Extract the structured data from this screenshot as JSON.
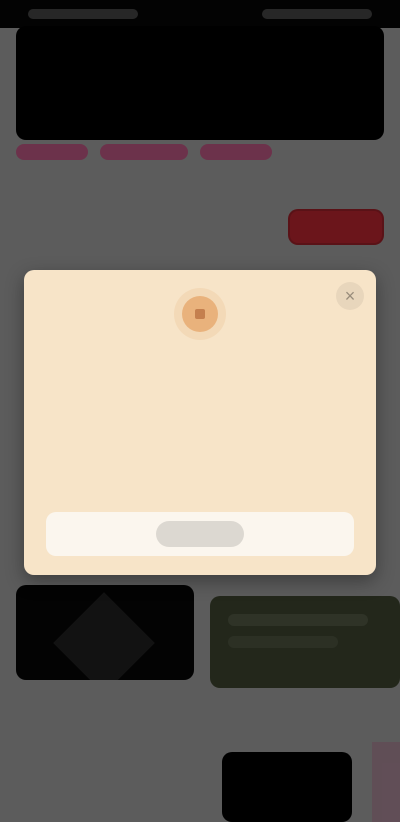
{
  "status_bar": {
    "time": "",
    "left_text": "",
    "right_text": ""
  },
  "header": {
    "title": "",
    "subtitle": ""
  },
  "tabs": [
    {
      "label": ""
    },
    {
      "label": ""
    },
    {
      "label": ""
    }
  ],
  "subheader": {
    "text": "",
    "button_label": ""
  },
  "modal": {
    "icon": "warning-icon",
    "close_icon": "close-icon",
    "body_text": "",
    "button_label": ""
  },
  "colors": {
    "background_overlay": "#7b7b7b",
    "header_bg": "#000000",
    "accent_pink": "#ab004a",
    "cta_red": "#8f1d25",
    "modal_bg": "#f7e4c8",
    "modal_footer_bg": "#fbf6ee"
  }
}
